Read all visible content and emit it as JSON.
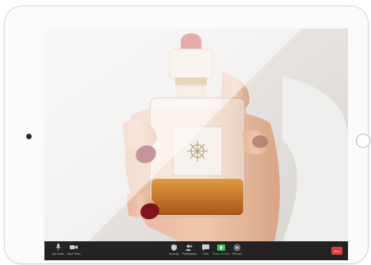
{
  "toolbar": {
    "left": [
      {
        "label": "Join Audio",
        "icon": "microphone-icon"
      },
      {
        "label": "Start Video",
        "icon": "video-camera-icon"
      }
    ],
    "center": [
      {
        "label": "Security",
        "icon": "shield-icon"
      },
      {
        "label": "Participants",
        "icon": "participants-icon"
      },
      {
        "label": "Chat",
        "icon": "chat-icon"
      },
      {
        "label": "Share Screen",
        "icon": "share-screen-icon"
      },
      {
        "label": "Record",
        "icon": "record-icon"
      }
    ],
    "end_label": "End"
  },
  "colors": {
    "toolbar_bg": "#232323",
    "share_green": "#3ec85c",
    "end_red": "#e03c31"
  }
}
